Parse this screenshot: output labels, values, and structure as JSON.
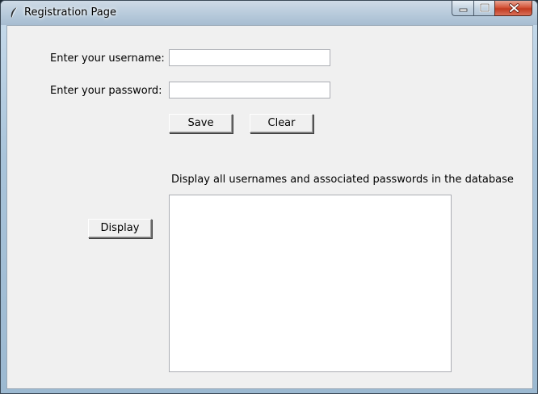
{
  "window": {
    "title": "Registration Page",
    "icon": "feather-icon"
  },
  "form": {
    "username_label": "Enter your username:",
    "username_value": "",
    "password_label": "Enter your password:",
    "password_value": "",
    "save_label": "Save",
    "clear_label": "Clear"
  },
  "display": {
    "caption": "Display all usernames and associated passwords in the database",
    "button_label": "Display",
    "items": []
  },
  "colors": {
    "client_bg": "#f0f0f0",
    "titlebar": "#b7cadb",
    "close_button": "#c23b20"
  }
}
